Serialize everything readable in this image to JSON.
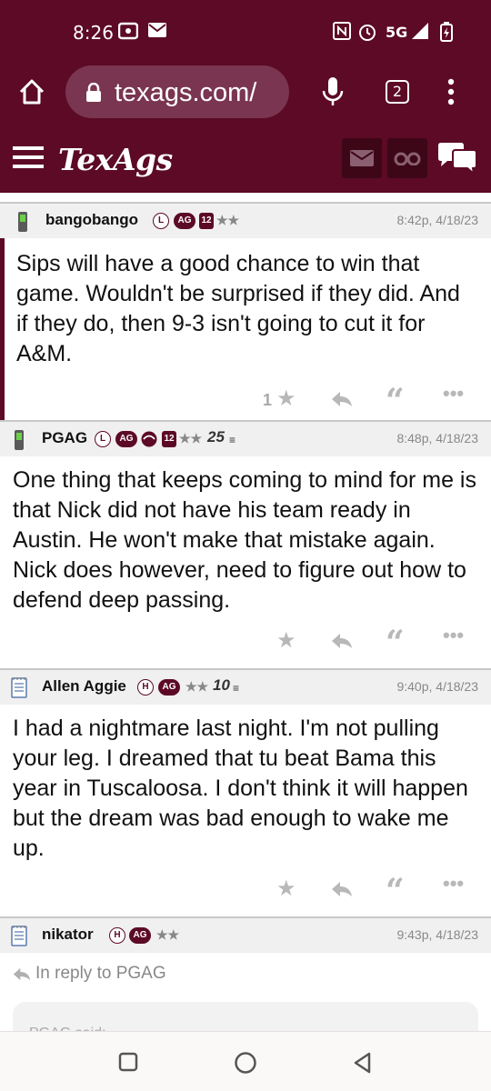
{
  "status_bar": {
    "time": "8:26",
    "network": "5G"
  },
  "browser": {
    "url": "texags.com/",
    "tab_count": "2"
  },
  "site": {
    "logo": "TexAgs"
  },
  "posts": [
    {
      "username": "bangobango",
      "badges": [
        "L",
        "AG",
        "12",
        "★★"
      ],
      "timestamp": "8:42p, 4/18/23",
      "body": "Sips will have a good chance to win that game. Wouldn't be surprised if they did. And if they do, then 9-3 isn't going to cut it for A&M.",
      "star_count": "1"
    },
    {
      "username": "PGAG",
      "badges": [
        "L",
        "AG",
        "12",
        "★★",
        "25"
      ],
      "timestamp": "8:48p, 4/18/23",
      "body": "One thing that keeps coming to mind for me is that Nick did not have his team ready in Austin. He won't make that mistake again. Nick does however, need to figure out how to defend deep passing.",
      "star_count": ""
    },
    {
      "username": "Allen Aggie",
      "badges": [
        "H",
        "AG",
        "★★",
        "10"
      ],
      "timestamp": "9:40p, 4/18/23",
      "body": "I had a nightmare last night. I'm not pulling your leg. I dreamed that tu beat Bama this year in Tuscaloosa. I don't think it will happen but the dream was bad enough to wake me up.",
      "star_count": ""
    },
    {
      "username": "nikator",
      "badges": [
        "H",
        "AG",
        "★★"
      ],
      "timestamp": "9:43p, 4/18/23",
      "reply_to": "In reply to PGAG",
      "quote_preview": "PGAG said:"
    }
  ],
  "colors": {
    "maroon": "#5c0a25",
    "header_gray": "#f0f0f0",
    "action_gray": "#b8b8b8"
  },
  "icons": [
    "home-icon",
    "lock-icon",
    "mic-icon",
    "more-vert-icon",
    "menu-icon",
    "mail-icon",
    "binoculars-icon",
    "chat-icon",
    "star-icon",
    "reply-icon",
    "quote-icon",
    "more-horiz-icon",
    "phone-icon",
    "notepad-icon",
    "nav-square-icon",
    "nav-circle-icon",
    "nav-back-icon"
  ]
}
